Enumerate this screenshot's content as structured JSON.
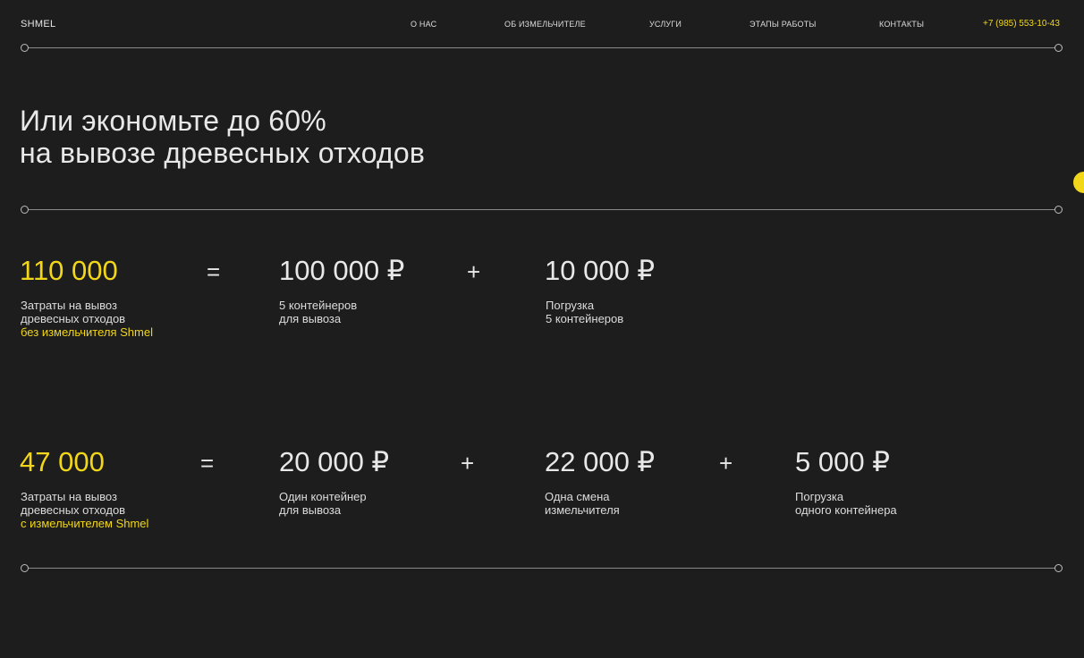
{
  "header": {
    "logo": "SHMEL",
    "nav": [
      "О НАС",
      "ОБ ИЗМЕЛЬЧИТЕЛЕ",
      "УСЛУГИ",
      "ЭТАПЫ РАБОТЫ",
      "КОНТАКТЫ"
    ],
    "phone": "+7 (985) 553-10-43"
  },
  "hero": {
    "line1": "Или экономьте до 60%",
    "line2": "на вывозе древесных отходов"
  },
  "row1": {
    "total": "110 000",
    "total_desc": [
      "Затраты на вывоз",
      "древесных отходов"
    ],
    "total_highlight": "без измельчителя Shmel",
    "eq": "=",
    "items": [
      {
        "value": "100 000 ₽",
        "desc": [
          "5 контейнеров",
          "для вывоза"
        ]
      },
      {
        "value": "10 000 ₽",
        "desc": [
          "Погрузка",
          "5 контейнеров"
        ]
      }
    ],
    "plus": "+"
  },
  "row2": {
    "total": "47 000",
    "total_desc": [
      "Затраты на вывоз",
      "древесных отходов"
    ],
    "total_highlight": "с измельчителем Shmel",
    "eq": "=",
    "items": [
      {
        "value": "20 000 ₽",
        "desc": [
          "Один контейнер",
          "для вывоза"
        ]
      },
      {
        "value": "22 000 ₽",
        "desc": [
          "Одна смена",
          "измельчителя"
        ]
      },
      {
        "value": "5 000 ₽",
        "desc": [
          "Погрузка",
          "одного контейнера"
        ]
      }
    ],
    "plus": "+"
  },
  "colors": {
    "background": "#1d1d1d",
    "accent": "#f2d61a",
    "text": "#e8e8e8"
  }
}
